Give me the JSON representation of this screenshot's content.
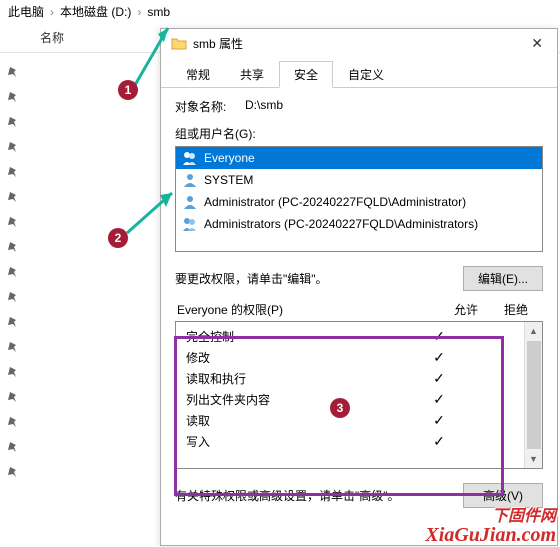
{
  "breadcrumb": {
    "parts": [
      "此电脑",
      "本地磁盘 (D:)",
      "smb"
    ]
  },
  "columns": {
    "name": "名称"
  },
  "dialog": {
    "title": "smb 属性",
    "tabs": {
      "general": "常规",
      "share": "共享",
      "security": "安全",
      "custom": "自定义"
    },
    "object_label": "对象名称:",
    "object_value": "D:\\smb",
    "group_label": "组或用户名(G):",
    "users": {
      "everyone": "Everyone",
      "system": "SYSTEM",
      "admin": "Administrator (PC-20240227FQLD\\Administrator)",
      "admins": "Administrators (PC-20240227FQLD\\Administrators)"
    },
    "edit_hint": "要更改权限，请单击\"编辑\"。",
    "edit_btn": "编辑(E)...",
    "perm_header": {
      "title": "Everyone 的权限(P)",
      "allow": "允许",
      "deny": "拒绝"
    },
    "perms": {
      "full": "完全控制",
      "modify": "修改",
      "readexec": "读取和执行",
      "listdir": "列出文件夹内容",
      "read": "读取",
      "write": "写入"
    },
    "adv_hint": "有关特殊权限或高级设置，请单击\"高级\"。",
    "adv_btn": "高级(V)"
  },
  "annotations": {
    "one": "1",
    "two": "2",
    "three": "3"
  },
  "watermark": {
    "cn": "下固件网",
    "en": "XiaGuJian.com"
  }
}
